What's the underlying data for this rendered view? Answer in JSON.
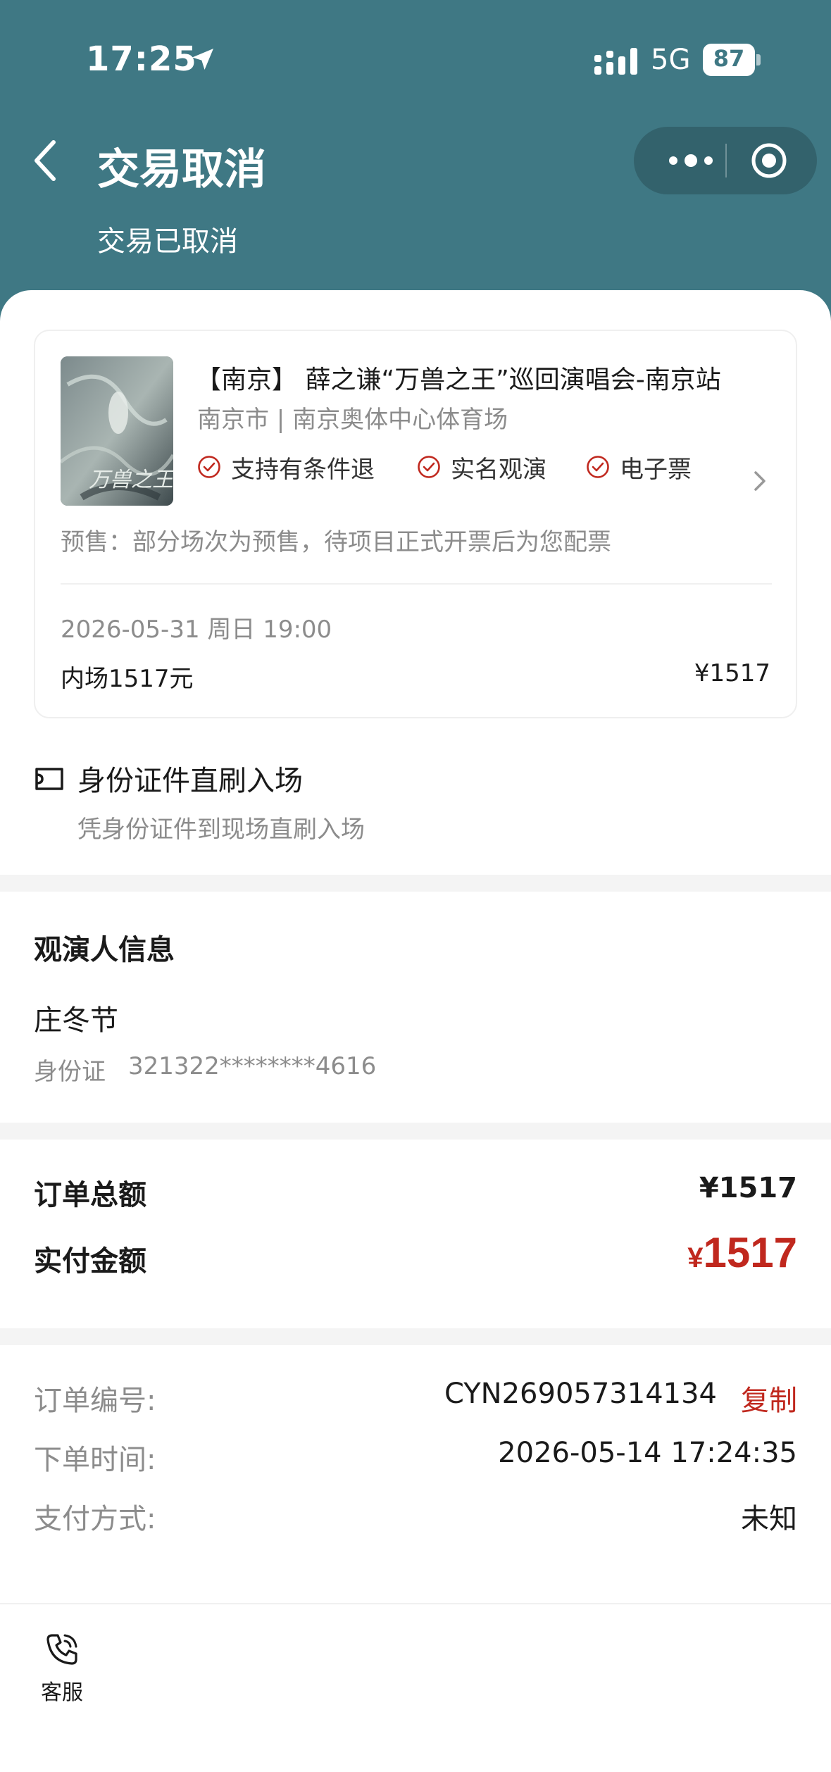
{
  "status_bar": {
    "time": "17:25",
    "network": "5G",
    "battery": "87",
    "icons": [
      "location-arrow-icon",
      "signal-icon",
      "battery-icon"
    ]
  },
  "nav": {
    "title": "交易取消",
    "back_icon": "chevron-left-icon",
    "more_icon": "more-dots-icon",
    "close_icon": "target-icon"
  },
  "status_text": "交易已取消",
  "show": {
    "title": "【南京】 薛之谦“万兽之王”巡回演唱会-南京站",
    "venue": "南京市 | 南京奥体中心体育场",
    "poster_text": "万兽之王",
    "tags": [
      "支持有条件退",
      "实名观演",
      "电子票"
    ],
    "presale": "预售：部分场次为预售，待项目正式开票后为您配票",
    "session_time": "2026-05-31 周日 19:00",
    "ticket_name": "内场1517元",
    "ticket_price": "¥1517"
  },
  "entry": {
    "title": "身份证件直刷入场",
    "desc": "凭身份证件到现场直刷入场"
  },
  "viewer": {
    "section_title": "观演人信息",
    "name": "庄冬节",
    "id_label": "身份证",
    "id_value": "321322********4616"
  },
  "amounts": {
    "total_label": "订单总额",
    "total_value": "¥1517",
    "paid_label": "实付金额",
    "paid_currency": "¥",
    "paid_value": "1517"
  },
  "order": {
    "no_label": "订单编号:",
    "no_value": "CYN269057314134",
    "copy_label": "复制",
    "time_label": "下单时间:",
    "time_value": "2026-05-14 17:24:35",
    "pay_label": "支付方式:",
    "pay_value": "未知"
  },
  "footer": {
    "service_label": "客服"
  },
  "colors": {
    "header": "#3f7884",
    "accent_red": "#c0281e",
    "muted": "#8c8c8c"
  }
}
